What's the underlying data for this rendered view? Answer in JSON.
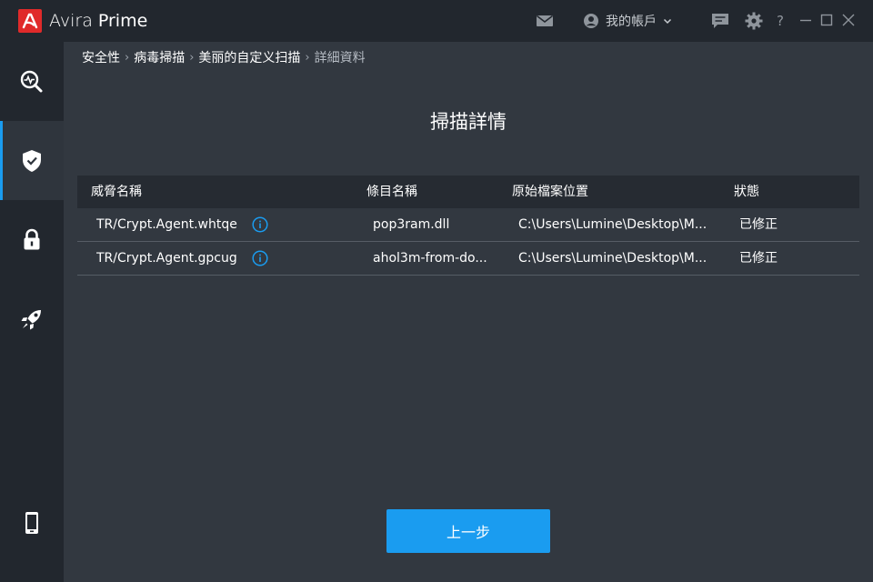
{
  "app": {
    "brand_name": "Avira",
    "brand_edition": "Prime",
    "account_label": "我的帳戶",
    "help_label": "?"
  },
  "icons": {
    "mail": "mail-icon",
    "account": "user-circle-icon",
    "feedback": "chat-icon",
    "settings": "gear-icon",
    "minimize": "minimize-icon",
    "maximize": "maximize-icon",
    "close": "close-icon",
    "nav": [
      "scan-status-icon",
      "shield-check-icon",
      "lock-icon",
      "rocket-icon",
      "mobile-phone-icon"
    ],
    "info": "info-icon"
  },
  "colors": {
    "accent": "#1a9cf0",
    "brand_red": "#e02a2a",
    "sidebar_bg": "#22272e",
    "content_bg": "#323840"
  },
  "breadcrumb": [
    "安全性",
    "病毒掃描",
    "美丽的自定义扫描",
    "詳細資料"
  ],
  "page": {
    "title": "掃描詳情",
    "back_label": "上一步"
  },
  "table": {
    "headers": [
      "威脅名稱",
      "條目名稱",
      "原始檔案位置",
      "狀態"
    ],
    "rows": [
      {
        "threat": "TR/Crypt.Agent.whtqe",
        "entry": "pop3ram.dll",
        "location": "C:\\Users\\Lumine\\Desktop\\M...",
        "status": "已修正"
      },
      {
        "threat": "TR/Crypt.Agent.gpcug",
        "entry": "ahol3m-from-do...",
        "location": "C:\\Users\\Lumine\\Desktop\\M...",
        "status": "已修正"
      }
    ]
  }
}
